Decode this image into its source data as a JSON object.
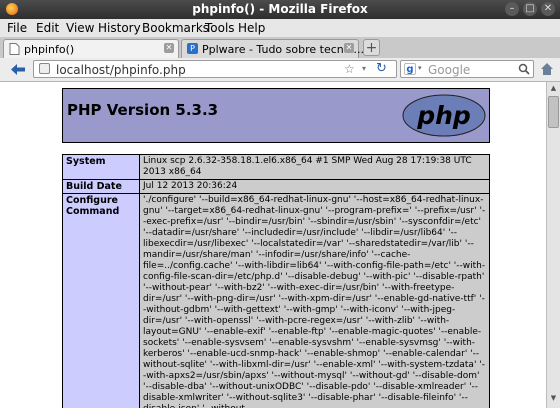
{
  "window": {
    "title": "phpinfo() - Mozilla Firefox"
  },
  "menu": [
    "File",
    "Edit",
    "View",
    "History",
    "Bookmarks",
    "Tools",
    "Help"
  ],
  "tabs": [
    {
      "label": "phpinfo()",
      "active": true
    },
    {
      "label": "Pplware - Tudo sobre tecnol...",
      "active": false
    }
  ],
  "nav": {
    "url": "localhost/phpinfo.php",
    "search_engine": "Google",
    "search_placeholder": "Google"
  },
  "page": {
    "version_title": "PHP Version 5.3.3",
    "logo_text": "php",
    "rows": [
      {
        "key": "System",
        "value": "Linux scp 2.6.32-358.18.1.el6.x86_64 #1 SMP Wed Aug 28 17:19:38 UTC 2013 x86_64"
      },
      {
        "key": "Build Date",
        "value": "Jul 12 2013 20:36:24"
      },
      {
        "key": "Configure Command",
        "value": "'./configure' '--build=x86_64-redhat-linux-gnu' '--host=x86_64-redhat-linux-gnu' '--target=x86_64-redhat-linux-gnu' '--program-prefix=' '--prefix=/usr' '--exec-prefix=/usr' '--bindir=/usr/bin' '--sbindir=/usr/sbin' '--sysconfdir=/etc' '--datadir=/usr/share' '--includedir=/usr/include' '--libdir=/usr/lib64' '--libexecdir=/usr/libexec' '--localstatedir=/var' '--sharedstatedir=/var/lib' '--mandir=/usr/share/man' '--infodir=/usr/share/info' '--cache-file=../config.cache' '--with-libdir=lib64' '--with-config-file-path=/etc' '--with-config-file-scan-dir=/etc/php.d' '--disable-debug' '--with-pic' '--disable-rpath' '--without-pear' '--with-bz2' '--with-exec-dir=/usr/bin' '--with-freetype-dir=/usr' '--with-png-dir=/usr' '--with-xpm-dir=/usr' '--enable-gd-native-ttf' '--without-gdbm' '--with-gettext' '--with-gmp' '--with-iconv' '--with-jpeg-dir=/usr' '--with-openssl' '--with-pcre-regex=/usr' '--with-zlib' '--with-layout=GNU' '--enable-exif' '--enable-ftp' '--enable-magic-quotes' '--enable-sockets' '--enable-sysvsem' '--enable-sysvshm' '--enable-sysvmsg' '--with-kerberos' '--enable-ucd-snmp-hack' '--enable-shmop' '--enable-calendar' '--without-sqlite' '--with-libxml-dir=/usr' '--enable-xml' '--with-system-tzdata' '--with-apxs2=/usr/sbin/apxs' '--without-mysql' '--without-gd' '--disable-dom' '--disable-dba' '--without-unixODBC' '--disable-pdo' '--disable-xmlreader' '--disable-xmlwriter' '--without-sqlite3' '--disable-phar' '--disable-fileinfo' '--disable-json' '--without-"
      }
    ]
  },
  "icons": {
    "back": "back-arrow-icon",
    "reload": "reload-icon",
    "bookmark": "bookmark-star-icon",
    "search": "search-icon"
  }
}
